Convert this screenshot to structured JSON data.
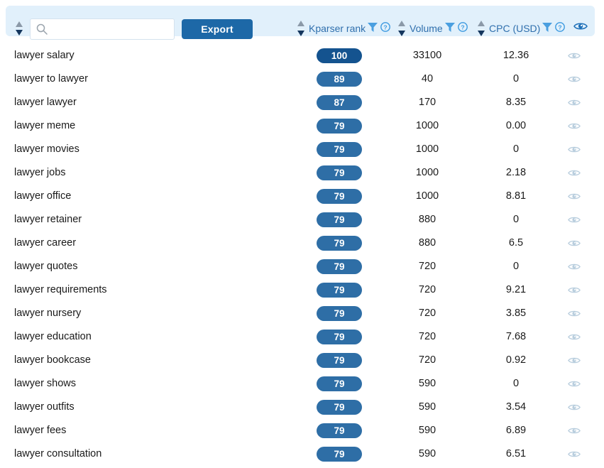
{
  "toolbar": {
    "sort_order": "desc",
    "search": {
      "value": "",
      "placeholder": ""
    },
    "export_label": "Export",
    "columns": [
      {
        "label": "Kparser rank",
        "icons": [
          "sort",
          "filter",
          "help"
        ]
      },
      {
        "label": "Volume",
        "icons": [
          "sort",
          "filter",
          "help"
        ]
      },
      {
        "label": "CPC (USD)",
        "icons": [
          "sort",
          "filter",
          "help"
        ]
      }
    ],
    "visibility_toggle": "eye-icon"
  },
  "colors": {
    "toolbar_bg": "#e1f0fb",
    "export_bg": "#1d68a7",
    "header_text": "#2f6fad",
    "badge_default": "#2e6ea6",
    "badge_top": "#14538f",
    "funnel": "#4a9fe0",
    "help": "#3d9ae0",
    "row_eye": "#b9cede",
    "header_eye": "#1d6fb8"
  },
  "rows": [
    {
      "keyword": "lawyer salary",
      "rank": "100",
      "volume": "33100",
      "cpc": "12.36"
    },
    {
      "keyword": "lawyer to lawyer",
      "rank": "89",
      "volume": "40",
      "cpc": "0"
    },
    {
      "keyword": "lawyer lawyer",
      "rank": "87",
      "volume": "170",
      "cpc": "8.35"
    },
    {
      "keyword": "lawyer meme",
      "rank": "79",
      "volume": "1000",
      "cpc": "0.00"
    },
    {
      "keyword": "lawyer movies",
      "rank": "79",
      "volume": "1000",
      "cpc": "0"
    },
    {
      "keyword": "lawyer jobs",
      "rank": "79",
      "volume": "1000",
      "cpc": "2.18"
    },
    {
      "keyword": "lawyer office",
      "rank": "79",
      "volume": "1000",
      "cpc": "8.81"
    },
    {
      "keyword": "lawyer retainer",
      "rank": "79",
      "volume": "880",
      "cpc": "0"
    },
    {
      "keyword": "lawyer career",
      "rank": "79",
      "volume": "880",
      "cpc": "6.5"
    },
    {
      "keyword": "lawyer quotes",
      "rank": "79",
      "volume": "720",
      "cpc": "0"
    },
    {
      "keyword": "lawyer requirements",
      "rank": "79",
      "volume": "720",
      "cpc": "9.21"
    },
    {
      "keyword": "lawyer nursery",
      "rank": "79",
      "volume": "720",
      "cpc": "3.85"
    },
    {
      "keyword": "lawyer education",
      "rank": "79",
      "volume": "720",
      "cpc": "7.68"
    },
    {
      "keyword": "lawyer bookcase",
      "rank": "79",
      "volume": "720",
      "cpc": "0.92"
    },
    {
      "keyword": "lawyer shows",
      "rank": "79",
      "volume": "590",
      "cpc": "0"
    },
    {
      "keyword": "lawyer outfits",
      "rank": "79",
      "volume": "590",
      "cpc": "3.54"
    },
    {
      "keyword": "lawyer fees",
      "rank": "79",
      "volume": "590",
      "cpc": "6.89"
    },
    {
      "keyword": "lawyer consultation",
      "rank": "79",
      "volume": "590",
      "cpc": "6.51"
    }
  ]
}
